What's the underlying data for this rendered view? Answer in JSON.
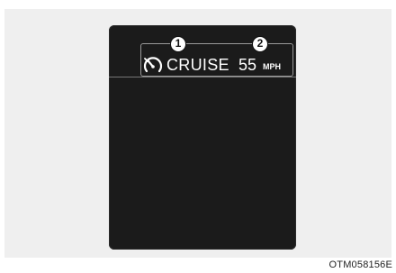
{
  "display": {
    "cruise_label": "CRUISE",
    "speed_value": "55",
    "speed_unit": "MPH",
    "icon": "cruise-control-speedometer-icon"
  },
  "callouts": [
    "1",
    "2"
  ],
  "caption": "OTM058156E",
  "colors": {
    "screen": "#1b1b1b",
    "text": "#ffffff",
    "background": "#efefef"
  }
}
